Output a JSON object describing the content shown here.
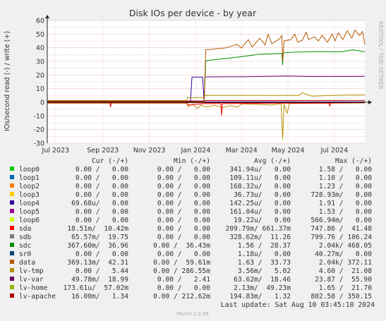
{
  "chart_data": {
    "type": "line",
    "title": "Disk IOs per device - by year",
    "ylabel": "IOs/second read (-) / write (+)",
    "watermark": "RRDTOOL / TOBI OETIKER",
    "footer": "Munin 2.0.56",
    "ylim": [
      -30,
      60
    ],
    "yticks": [
      -30,
      -20,
      -10,
      0,
      10,
      20,
      30,
      40,
      50,
      60
    ],
    "xlim": [
      "2023-06-20",
      "2024-08-10"
    ],
    "xticks": [
      {
        "date": "2023-07-01",
        "label": "Jul 2023"
      },
      {
        "date": "2023-09-01",
        "label": "Sep 2023"
      },
      {
        "date": "2023-11-01",
        "label": "Nov 2023"
      },
      {
        "date": "2024-01-01",
        "label": "Jan 2024"
      },
      {
        "date": "2024-03-01",
        "label": "Mar 2024"
      },
      {
        "date": "2024-05-01",
        "label": "May 2024"
      },
      {
        "date": "2024-07-01",
        "label": "Jul 2024"
      }
    ],
    "grid": true,
    "legend_headers": [
      "Cur (-/+)",
      "Min (-/+)",
      "Avg (-/+)",
      "Max (-/+)"
    ],
    "series": [
      {
        "name": "loop0",
        "color": "#00cc00",
        "cur": "0.00 /   0.00",
        "min": "0.00 /   0.00",
        "avg": "341.94u/   0.00",
        "max": "1.58 /   0.00"
      },
      {
        "name": "loop1",
        "color": "#0066b3",
        "cur": "0.00 /   0.00",
        "min": "0.00 /   0.00",
        "avg": "109.11u/   0.00",
        "max": "1.10 /   0.00"
      },
      {
        "name": "loop2",
        "color": "#ff8000",
        "cur": "0.00 /   0.00",
        "min": "0.00 /   0.00",
        "avg": "168.32u/   0.00",
        "max": "1.23 /   0.00"
      },
      {
        "name": "loop3",
        "color": "#ffcc00",
        "cur": "0.00 /   0.00",
        "min": "0.00 /   0.00",
        "avg": "36.73u/   0.00",
        "max": "728.93m/   0.00"
      },
      {
        "name": "loop4",
        "color": "#330099",
        "cur": "69.68u/   0.00",
        "min": "0.00 /   0.00",
        "avg": "142.25u/   0.00",
        "max": "1.91 /   0.00"
      },
      {
        "name": "loop5",
        "color": "#990099",
        "cur": "0.00 /   0.00",
        "min": "0.00 /   0.00",
        "avg": "161.04u/   0.00",
        "max": "1.53 /   0.00"
      },
      {
        "name": "loop6",
        "color": "#ccff00",
        "cur": "0.00 /   0.00",
        "min": "0.00 /   0.00",
        "avg": "19.22u/   0.00",
        "max": "566.94m/   0.00"
      },
      {
        "name": "sda",
        "color": "#ff0000",
        "cur": "18.51m/  10.42m",
        "min": "0.00 /   0.00",
        "avg": "209.79m/ 661.37m",
        "max": "747.86 /  41.48"
      },
      {
        "name": "sdb",
        "color": "#808080",
        "cur": "65.57m/  19.75",
        "min": "0.00 /   0.00",
        "avg": "328.62m/  11.26",
        "max": "799.76 / 106.24"
      },
      {
        "name": "sdc",
        "color": "#008f00",
        "cur": "367.60m/  36.96",
        "min": "0.00 /  36.43m",
        "avg": "1.56 /  28.37",
        "max": "2.04k/ 468.05"
      },
      {
        "name": "sr0",
        "color": "#00487d",
        "cur": "0.00 /   0.00",
        "min": "0.00 /   0.00",
        "avg": "1.18u/   0.00",
        "max": "40.27m/   0.00"
      },
      {
        "name": "data",
        "color": "#b35a00",
        "cur": "369.13m/  42.31",
        "min": "0.00 /  59.61m",
        "avg": "1.63 /  33.73",
        "max": "2.04k/ 372.11"
      },
      {
        "name": "lv-tmp",
        "color": "#b38f00",
        "cur": "0.00 /   5.44",
        "min": "0.00 / 286.55m",
        "avg": "3.56m/   5.02",
        "max": "4.60 /  21.08"
      },
      {
        "name": "lv-var",
        "color": "#6b006b",
        "cur": "49.78m/  18.99",
        "min": "0.00 /   2.41",
        "avg": "63.62m/  18.46",
        "max": "23.87 /  55.90"
      },
      {
        "name": "lv-home",
        "color": "#8fb300",
        "cur": "173.61u/  57.02m",
        "min": "0.00 /   0.00",
        "avg": "2.13m/  49.23m",
        "max": "1.65 /  21.70"
      },
      {
        "name": "lv-apache",
        "color": "#b30000",
        "cur": "16.00m/   1.34",
        "min": "0.00 / 212.62m",
        "avg": "194.83m/   1.32",
        "max": "802.58 / 350.15"
      }
    ],
    "curves": [
      {
        "series": "loop4",
        "points": [
          [
            "2023-06-20",
            0.3
          ],
          [
            "2023-12-25",
            0.3
          ],
          [
            "2023-12-27",
            18.5
          ],
          [
            "2024-01-10",
            18.5
          ],
          [
            "2024-01-12",
            0.3
          ],
          [
            "2024-08-10",
            0.3
          ]
        ]
      },
      {
        "series": "lv-var",
        "points": [
          [
            "2023-06-20",
            1.0
          ],
          [
            "2024-01-12",
            1.0
          ],
          [
            "2024-01-13",
            18.6
          ],
          [
            "2024-03-10",
            18.8
          ],
          [
            "2024-05-01",
            19.2
          ],
          [
            "2024-06-01",
            18.9
          ],
          [
            "2024-08-10",
            19.0
          ]
        ]
      },
      {
        "series": "lv-tmp",
        "points": [
          [
            "2023-06-20",
            1.3
          ],
          [
            "2023-12-20",
            1.3
          ],
          [
            "2023-12-21",
            3.5
          ],
          [
            "2024-01-12",
            3.5
          ],
          [
            "2024-01-13",
            5.1
          ],
          [
            "2024-05-15",
            5.0
          ],
          [
            "2024-05-20",
            7.0
          ],
          [
            "2024-06-01",
            4.5
          ],
          [
            "2024-07-15",
            5.3
          ],
          [
            "2024-08-10",
            5.4
          ]
        ]
      },
      {
        "series": "lv-apache",
        "points": [
          [
            "2023-06-20",
            0.8
          ],
          [
            "2024-01-12",
            0.8
          ],
          [
            "2024-01-13",
            1.3
          ],
          [
            "2024-08-10",
            1.34
          ]
        ]
      },
      {
        "series": "sdc",
        "points": [
          [
            "2023-06-20",
            0.2
          ],
          [
            "2024-01-12",
            0.2
          ],
          [
            "2024-01-14",
            30.5
          ],
          [
            "2024-02-15",
            32.5
          ],
          [
            "2024-03-01",
            33.5
          ],
          [
            "2024-03-25",
            35.2
          ],
          [
            "2024-04-23",
            35.8
          ],
          [
            "2024-04-24",
            27.5
          ],
          [
            "2024-04-25",
            36.2
          ],
          [
            "2024-05-10",
            36.8
          ],
          [
            "2024-06-10",
            37.2
          ],
          [
            "2024-07-10",
            37.0
          ],
          [
            "2024-07-25",
            38.5
          ],
          [
            "2024-08-10",
            37.0
          ]
        ]
      },
      {
        "series": "data",
        "points": [
          [
            "2023-06-20",
            0.2
          ],
          [
            "2024-01-12",
            0.2
          ],
          [
            "2024-01-14",
            38.5
          ],
          [
            "2024-02-10",
            40.0
          ],
          [
            "2024-02-24",
            42.5
          ],
          [
            "2024-03-01",
            39.8
          ],
          [
            "2024-03-10",
            46.0
          ],
          [
            "2024-03-15",
            40.5
          ],
          [
            "2024-03-25",
            47.0
          ],
          [
            "2024-04-01",
            42.0
          ],
          [
            "2024-04-05",
            50.0
          ],
          [
            "2024-04-10",
            43.0
          ],
          [
            "2024-04-20",
            46.5
          ],
          [
            "2024-04-23",
            49.0
          ],
          [
            "2024-04-24",
            30.0
          ],
          [
            "2024-04-26",
            45.0
          ],
          [
            "2024-05-05",
            46.0
          ],
          [
            "2024-05-10",
            50.0
          ],
          [
            "2024-05-14",
            44.0
          ],
          [
            "2024-05-20",
            45.5
          ],
          [
            "2024-05-25",
            51.5
          ],
          [
            "2024-05-28",
            46.0
          ],
          [
            "2024-06-05",
            48.0
          ],
          [
            "2024-06-10",
            45.0
          ],
          [
            "2024-06-15",
            49.0
          ],
          [
            "2024-06-22",
            44.0
          ],
          [
            "2024-06-28",
            50.0
          ],
          [
            "2024-07-02",
            45.0
          ],
          [
            "2024-07-06",
            51.0
          ],
          [
            "2024-07-12",
            46.0
          ],
          [
            "2024-07-18",
            52.5
          ],
          [
            "2024-07-24",
            47.0
          ],
          [
            "2024-07-28",
            53.0
          ],
          [
            "2024-08-03",
            49.0
          ],
          [
            "2024-08-07",
            52.0
          ],
          [
            "2024-08-10",
            42.3
          ]
        ]
      },
      {
        "series": "lv-tmp",
        "points": [
          [
            "2023-06-20",
            -0.6
          ],
          [
            "2023-12-20",
            -0.6
          ],
          [
            "2023-12-22",
            -3.0
          ],
          [
            "2023-12-28",
            -1.5
          ],
          [
            "2024-01-03",
            -4.5
          ],
          [
            "2024-01-08",
            -2.0
          ],
          [
            "2024-01-15",
            -3.5
          ],
          [
            "2024-01-25",
            -2.2
          ],
          [
            "2024-02-05",
            -4.0
          ],
          [
            "2024-02-15",
            -2.5
          ],
          [
            "2024-02-25",
            -3.5
          ],
          [
            "2024-03-01",
            -1.2
          ],
          [
            "2024-03-20",
            -1.5
          ],
          [
            "2024-04-10",
            -2.0
          ],
          [
            "2024-04-22",
            -1.0
          ],
          [
            "2024-04-24",
            -27.0
          ],
          [
            "2024-04-26",
            -1.5
          ],
          [
            "2024-04-30",
            -8.0
          ],
          [
            "2024-05-03",
            -1.0
          ],
          [
            "2024-05-20",
            -0.8
          ],
          [
            "2024-08-10",
            -0.5
          ]
        ]
      },
      {
        "series": "sda",
        "points": [
          [
            "2023-06-20",
            -0.4
          ],
          [
            "2023-09-10",
            -0.4
          ],
          [
            "2023-09-11",
            -3.5
          ],
          [
            "2023-09-12",
            -0.4
          ],
          [
            "2023-12-20",
            -0.4
          ],
          [
            "2023-12-22",
            -2.0
          ],
          [
            "2024-01-12",
            -1.0
          ],
          [
            "2024-02-03",
            -1.0
          ],
          [
            "2024-02-04",
            -9.5
          ],
          [
            "2024-02-05",
            -1.0
          ],
          [
            "2024-05-01",
            -0.6
          ],
          [
            "2024-06-24",
            -0.6
          ],
          [
            "2024-06-25",
            -3.0
          ],
          [
            "2024-06-26",
            -0.5
          ],
          [
            "2024-08-10",
            -0.2
          ]
        ]
      },
      {
        "series": "lv-var",
        "points": [
          [
            "2023-06-20",
            -0.2
          ],
          [
            "2024-08-10",
            -0.2
          ]
        ]
      },
      {
        "series": "lv-apache",
        "points": [
          [
            "2023-06-20",
            -0.3
          ],
          [
            "2024-08-10",
            -0.3
          ]
        ]
      }
    ]
  },
  "footer_text": {
    "last_update": "Last update: Sat Aug 10 03:45:10 2024"
  }
}
